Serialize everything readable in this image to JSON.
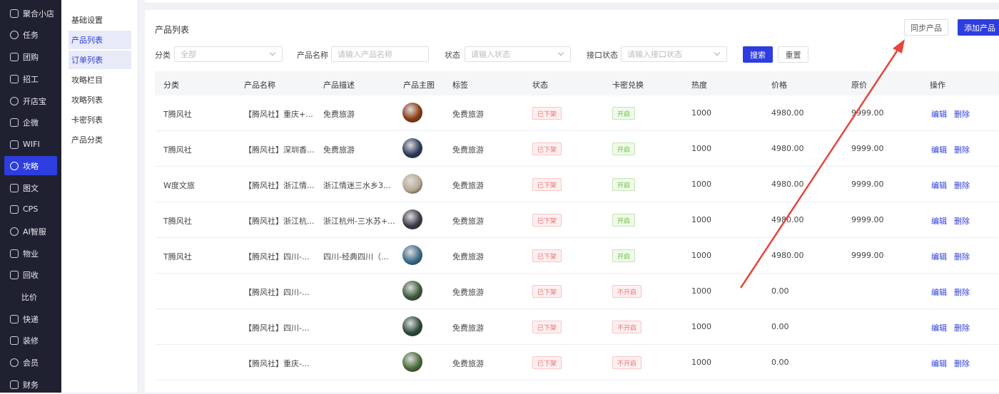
{
  "sidebar": {
    "items": [
      {
        "label": "聚合小店",
        "icon": "store-icon",
        "active": false
      },
      {
        "label": "任务",
        "icon": "target-icon",
        "active": false
      },
      {
        "label": "团购",
        "icon": "shop-icon",
        "active": false
      },
      {
        "label": "招工",
        "icon": "layers-icon",
        "active": false
      },
      {
        "label": "开店宝",
        "icon": "bag-icon",
        "active": false
      },
      {
        "label": "企微",
        "icon": "chat-icon",
        "active": false
      },
      {
        "label": "WIFI",
        "icon": "wifi-icon",
        "active": false
      },
      {
        "label": "攻略",
        "icon": "layers-icon",
        "active": true
      },
      {
        "label": "图文",
        "icon": "image-icon",
        "active": false
      },
      {
        "label": "CPS",
        "icon": "home-icon",
        "active": false
      },
      {
        "label": "AI智服",
        "icon": "user-icon",
        "active": false
      },
      {
        "label": "物业",
        "icon": "building-icon",
        "active": false
      },
      {
        "label": "回收",
        "icon": "recycle-icon",
        "active": false
      },
      {
        "label": "比价",
        "icon": "",
        "active": false
      },
      {
        "label": "快递",
        "icon": "package-icon",
        "active": false
      },
      {
        "label": "装修",
        "icon": "paint-icon",
        "active": false
      },
      {
        "label": "会员",
        "icon": "heart-icon",
        "active": false
      },
      {
        "label": "财务",
        "icon": "wallet-icon",
        "active": false
      }
    ]
  },
  "subnav": {
    "items": [
      {
        "label": "基础设置",
        "active": false
      },
      {
        "label": "产品列表",
        "active": true
      },
      {
        "label": "订单列表",
        "active": true
      },
      {
        "label": "攻略栏目",
        "active": false
      },
      {
        "label": "攻略列表",
        "active": false
      },
      {
        "label": "卡密列表",
        "active": false
      },
      {
        "label": "产品分类",
        "active": false
      }
    ]
  },
  "main": {
    "title": "产品列表",
    "sync_button": "同步产品",
    "add_button": "添加产品",
    "filters": {
      "category_label": "分类",
      "category_value": "全部",
      "name_label": "产品名称",
      "name_placeholder": "请输入产品名称",
      "status_label": "状态",
      "status_placeholder": "请输入状态",
      "api_status_label": "接口状态",
      "api_status_placeholder": "请输入接口状态",
      "search_button": "搜索",
      "reset_button": "重置"
    },
    "columns": [
      "分类",
      "产品名称",
      "产品描述",
      "产品主图",
      "标签",
      "状态",
      "卡密兑换",
      "热度",
      "价格",
      "原价",
      "操作"
    ],
    "rows": [
      {
        "category": "T腾风社",
        "name": "【腾风社】重庆+...",
        "desc": "免费旅游",
        "tag": "免费旅游",
        "status": "已下架",
        "card": "开启",
        "card_on": true,
        "heat": "1000",
        "price": "4980.00",
        "orig": "9999.00",
        "edit": "编辑",
        "del": "删除",
        "img": "#8a3a10"
      },
      {
        "category": "T腾风社",
        "name": "【腾风社】深圳香...",
        "desc": "免费旅游",
        "tag": "免费旅游",
        "status": "已下架",
        "card": "开启",
        "card_on": true,
        "heat": "1000",
        "price": "4980.00",
        "orig": "9999.00",
        "edit": "编辑",
        "del": "删除",
        "img": "#2a3a5a"
      },
      {
        "category": "W度文旅",
        "name": "【腾风社】浙江情...",
        "desc": "浙江情迷三水乡3...",
        "tag": "免费旅游",
        "status": "已下架",
        "card": "开启",
        "card_on": true,
        "heat": "1000",
        "price": "4980.00",
        "orig": "9999.00",
        "edit": "编辑",
        "del": "删除",
        "img": "#b8a890"
      },
      {
        "category": "T腾风社",
        "name": "【腾风社】浙江杭...",
        "desc": "浙江杭州-三水苏+...",
        "tag": "免费旅游",
        "status": "已下架",
        "card": "开启",
        "card_on": true,
        "heat": "1000",
        "price": "4980.00",
        "orig": "9999.00",
        "edit": "编辑",
        "del": "删除",
        "img": "#3a3a48"
      },
      {
        "category": "T腾风社",
        "name": "【腾风社】四川-...",
        "desc": "四川-经典四川（...",
        "tag": "免费旅游",
        "status": "已下架",
        "card": "开启",
        "card_on": true,
        "heat": "1000",
        "price": "4980.00",
        "orig": "9999.00",
        "edit": "编辑",
        "del": "删除",
        "img": "#3a6a8a"
      },
      {
        "category": "",
        "name": "【腾风社】四川-...",
        "desc": "",
        "tag": "免费旅游",
        "status": "已下架",
        "card": "不开启",
        "card_on": false,
        "heat": "1000",
        "price": "0.00",
        "orig": "",
        "edit": "编辑",
        "del": "删除",
        "img": "#3a5a3a"
      },
      {
        "category": "",
        "name": "【腾风社】四川-...",
        "desc": "",
        "tag": "免费旅游",
        "status": "已下架",
        "card": "不开启",
        "card_on": false,
        "heat": "1000",
        "price": "0.00",
        "orig": "",
        "edit": "编辑",
        "del": "删除",
        "img": "#2a4a3a"
      },
      {
        "category": "",
        "name": "【腾风社】重庆-...",
        "desc": "",
        "tag": "免费旅游",
        "status": "已下架",
        "card": "不开启",
        "card_on": false,
        "heat": "1000",
        "price": "0.00",
        "orig": "",
        "edit": "编辑",
        "del": "删除",
        "img": "#4a6a3a"
      }
    ]
  },
  "colors": {
    "accent": "#2d3de0",
    "sidebar_bg": "#1f2130",
    "arrow": "#e8453c"
  }
}
